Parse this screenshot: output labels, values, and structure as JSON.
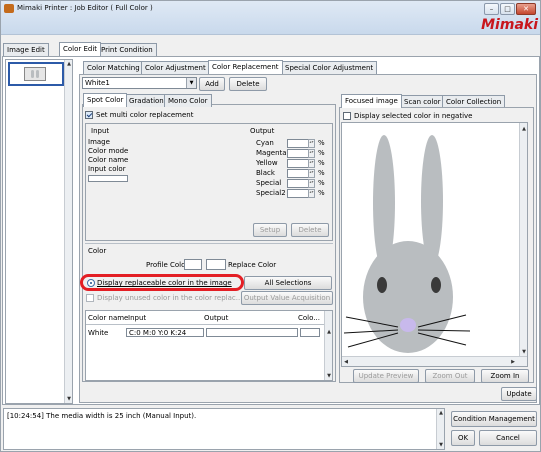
{
  "window": {
    "title": "Mimaki Printer : Job Editor ( Full Color )",
    "brand": "Mimaki",
    "controls": [
      "–",
      "□",
      "✕"
    ]
  },
  "main_tabs": [
    "Image Edit",
    "Color Edit",
    "Print Condition"
  ],
  "sub_tabs": [
    "Color Matching",
    "Color Adjustment",
    "Color Replacement",
    "Special Color Adjustment"
  ],
  "preset": {
    "value": "White1",
    "add": "Add",
    "delete": "Delete"
  },
  "mode_tabs": [
    "Spot Color",
    "Gradation",
    "Mono Color"
  ],
  "multi_replacement": "Set multi color replacement",
  "input_group": {
    "title": "Input",
    "rows": [
      "Image",
      "Color mode",
      "Color name",
      "Input color"
    ]
  },
  "output_group": {
    "title": "Output",
    "channels": [
      "Cyan",
      "Magenta",
      "Yellow",
      "Black",
      "Special",
      "Special2"
    ],
    "unit": "%"
  },
  "setup_button": "Setup",
  "delete_button": "Delete",
  "color_section": {
    "title": "Color",
    "profile_color": "Profile Color",
    "replace_color": "Replace Color"
  },
  "display_replaceable": "Display replaceable color in the image",
  "all_selections": "All Selections",
  "display_unused": "Display unused color in the color replac...",
  "output_value_acquisition": "Output Value Acquisition",
  "table": {
    "headers": [
      "Color name",
      "Input",
      "Output",
      "Colo..."
    ],
    "rows": [
      {
        "name": "White",
        "input": "C:0 M:0 Y:0 K:24",
        "output": "",
        "color": ""
      }
    ]
  },
  "preview_tabs": [
    "Focused image",
    "Scan color",
    "Color Collection"
  ],
  "display_negative": "Display selected color in negative",
  "preview_buttons": {
    "update_preview": "Update Preview",
    "zoom_out": "Zoom Out",
    "zoom_in": "Zoom In"
  },
  "update_button": "Update",
  "log_text": "[10:24:54] The media width is 25 inch (Manual Input).",
  "condition_management": "Condition Management",
  "ok_button": "OK",
  "cancel_button": "Cancel",
  "colors": {
    "highlight": "#e31e24",
    "rabbit": "#b9bdc0",
    "nose": "#c8b9ec"
  }
}
